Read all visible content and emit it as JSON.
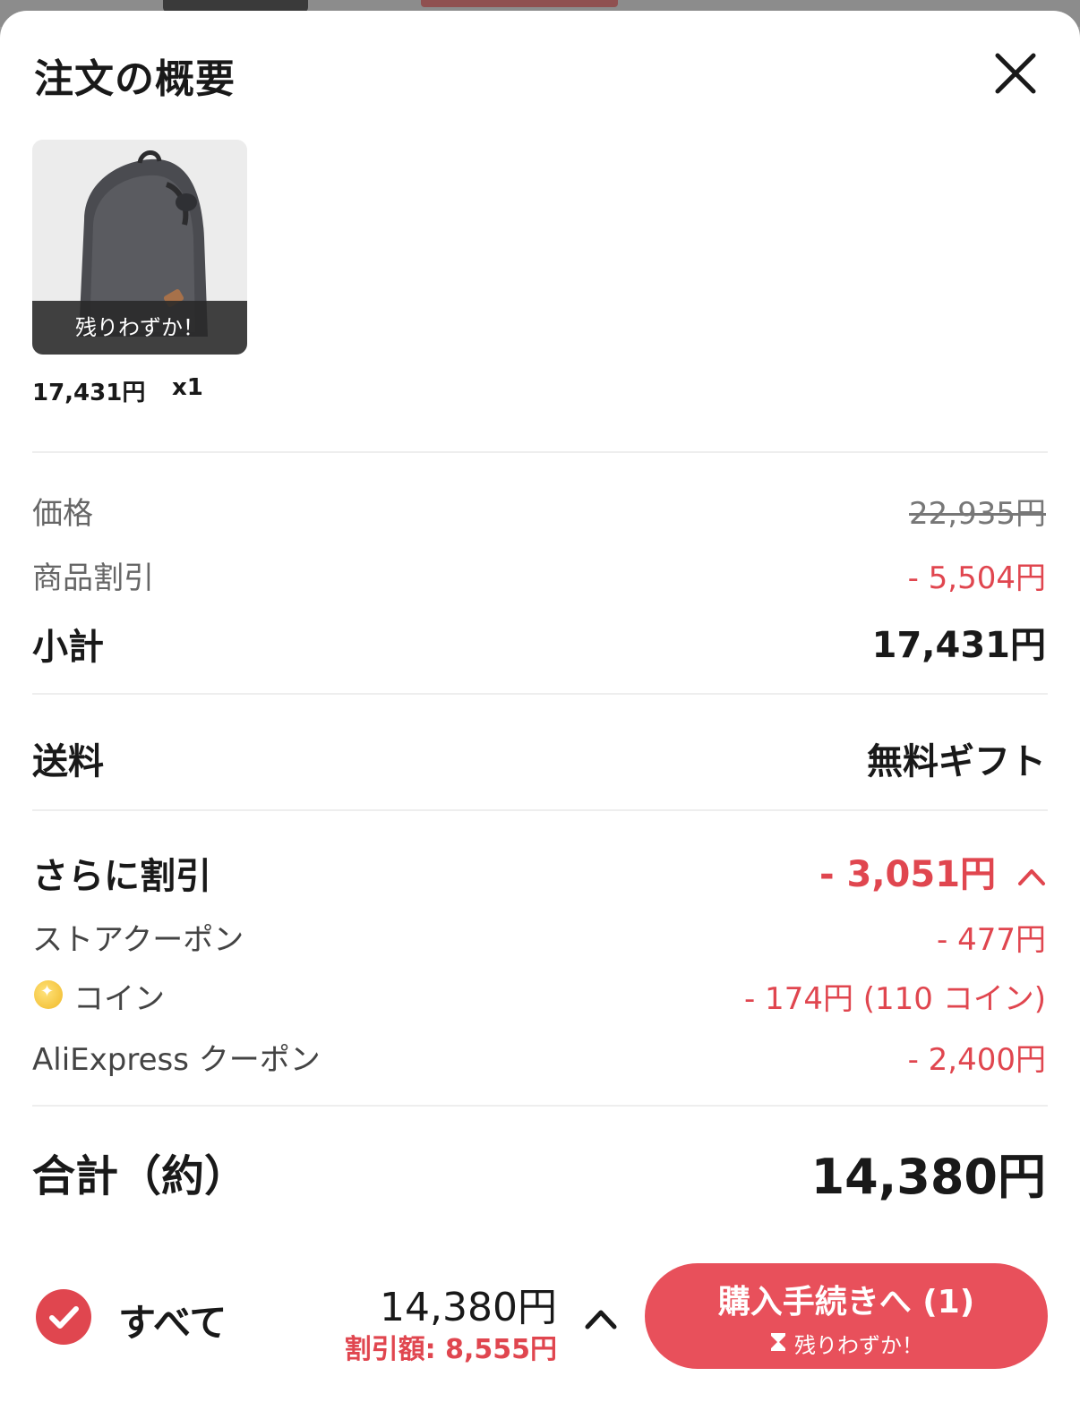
{
  "header": {
    "title": "注文の概要"
  },
  "item": {
    "badge": "残りわずか！",
    "price": "17,431円",
    "qty": "x1"
  },
  "summary": {
    "price_label": "価格",
    "price_value": "22,935円",
    "product_discount_label": "商品割引",
    "product_discount_value": "- 5,504円",
    "subtotal_label": "小計",
    "subtotal_value": "17,431円"
  },
  "shipping": {
    "label": "送料",
    "value": "無料ギフト"
  },
  "extra_discount": {
    "label": "さらに割引",
    "value": "- 3,051円",
    "items": [
      {
        "label": "ストアクーポン",
        "value": "- 477円"
      },
      {
        "label": "コイン",
        "value": "- 174円 (110 コイン)"
      },
      {
        "label": "AliExpress クーポン",
        "value": "- 2,400円"
      }
    ]
  },
  "total": {
    "label": "合計（約）",
    "value": "14,380円"
  },
  "bottom_bar": {
    "all_label": "すべて",
    "total": "14,380円",
    "discount": "割引額: 8,555円",
    "checkout_label": "購入手続きへ (1)",
    "checkout_sub": "残りわずか！"
  },
  "colors": {
    "accent": "#e0464f",
    "button": "#e8505b",
    "text": "#191919",
    "muted": "#666666"
  }
}
